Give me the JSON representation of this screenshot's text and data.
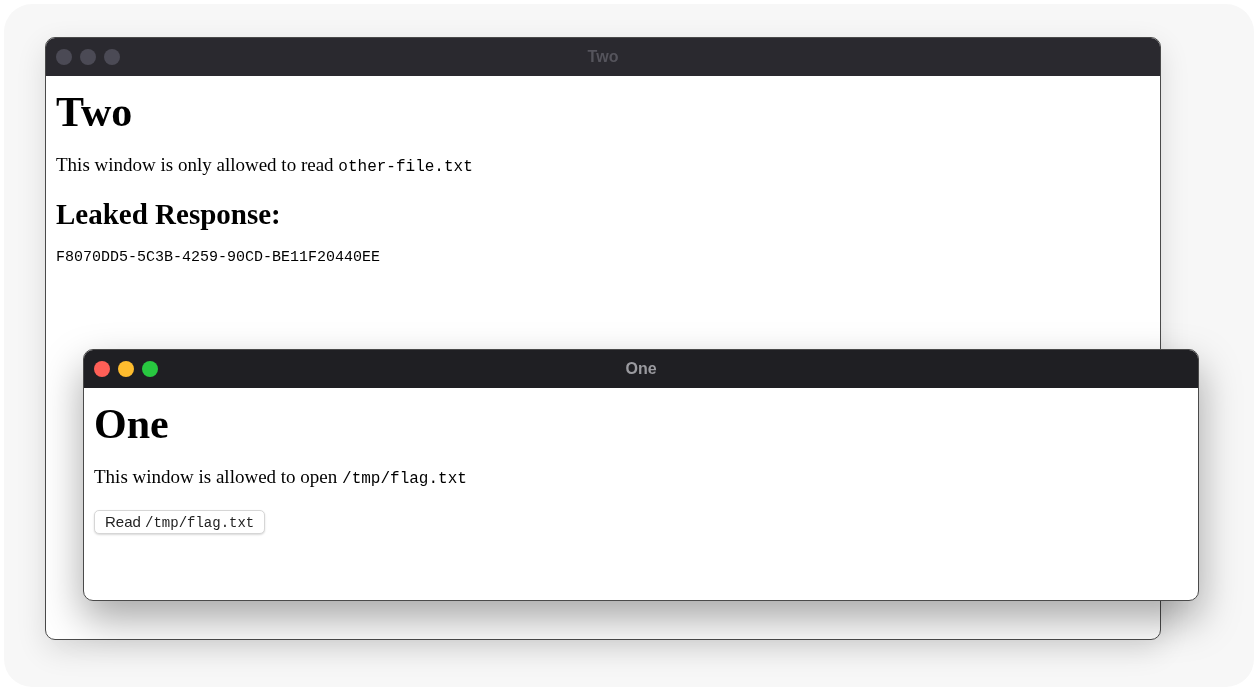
{
  "windows": [
    {
      "title": "Two",
      "active": false,
      "heading": "Two",
      "paragraph": {
        "text": "This window is only allowed to read",
        "code": "other-file.txt"
      },
      "subheading": "Leaked Response:",
      "response": "F8070DD5-5C3B-4259-90CD-BE11F20440EE"
    },
    {
      "title": "One",
      "active": true,
      "heading": "One",
      "paragraph": {
        "text": "This window is allowed to open",
        "code": "/tmp/flag.txt"
      },
      "button": {
        "text": "Read",
        "code": "/tmp/flag.txt"
      }
    }
  ]
}
